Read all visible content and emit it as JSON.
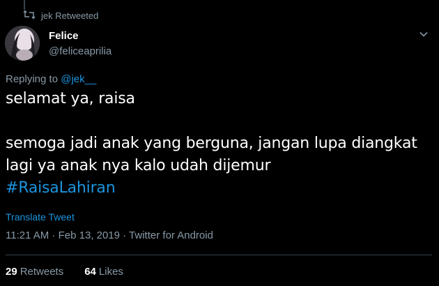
{
  "retweet": {
    "label": "jek Retweeted"
  },
  "author": {
    "name": "Felice",
    "handle": "@feliceaprilia"
  },
  "reply": {
    "prefix": "Replying to ",
    "mention": "@jek__"
  },
  "tweet": {
    "line1": "selamat ya, raisa",
    "line2": "semoga jadi anak yang berguna, jangan lupa diangkat",
    "line3": "lagi ya anak nya kalo udah dijemur",
    "hashtag": "#RaisaLahiran"
  },
  "translate_label": "Translate Tweet",
  "meta": "11:21 AM · Feb 13, 2019 · Twitter for Android",
  "stats": {
    "retweets_count": "29",
    "retweets_label": "Retweets",
    "likes_count": "64",
    "likes_label": "Likes"
  },
  "icons": {
    "retweet": "retweet-icon",
    "caret": "chevron-down-icon",
    "avatar": "avatar"
  },
  "colors": {
    "background": "#000000",
    "link": "#1b95e0",
    "secondary": "#8899a6",
    "divider": "#38444d"
  }
}
